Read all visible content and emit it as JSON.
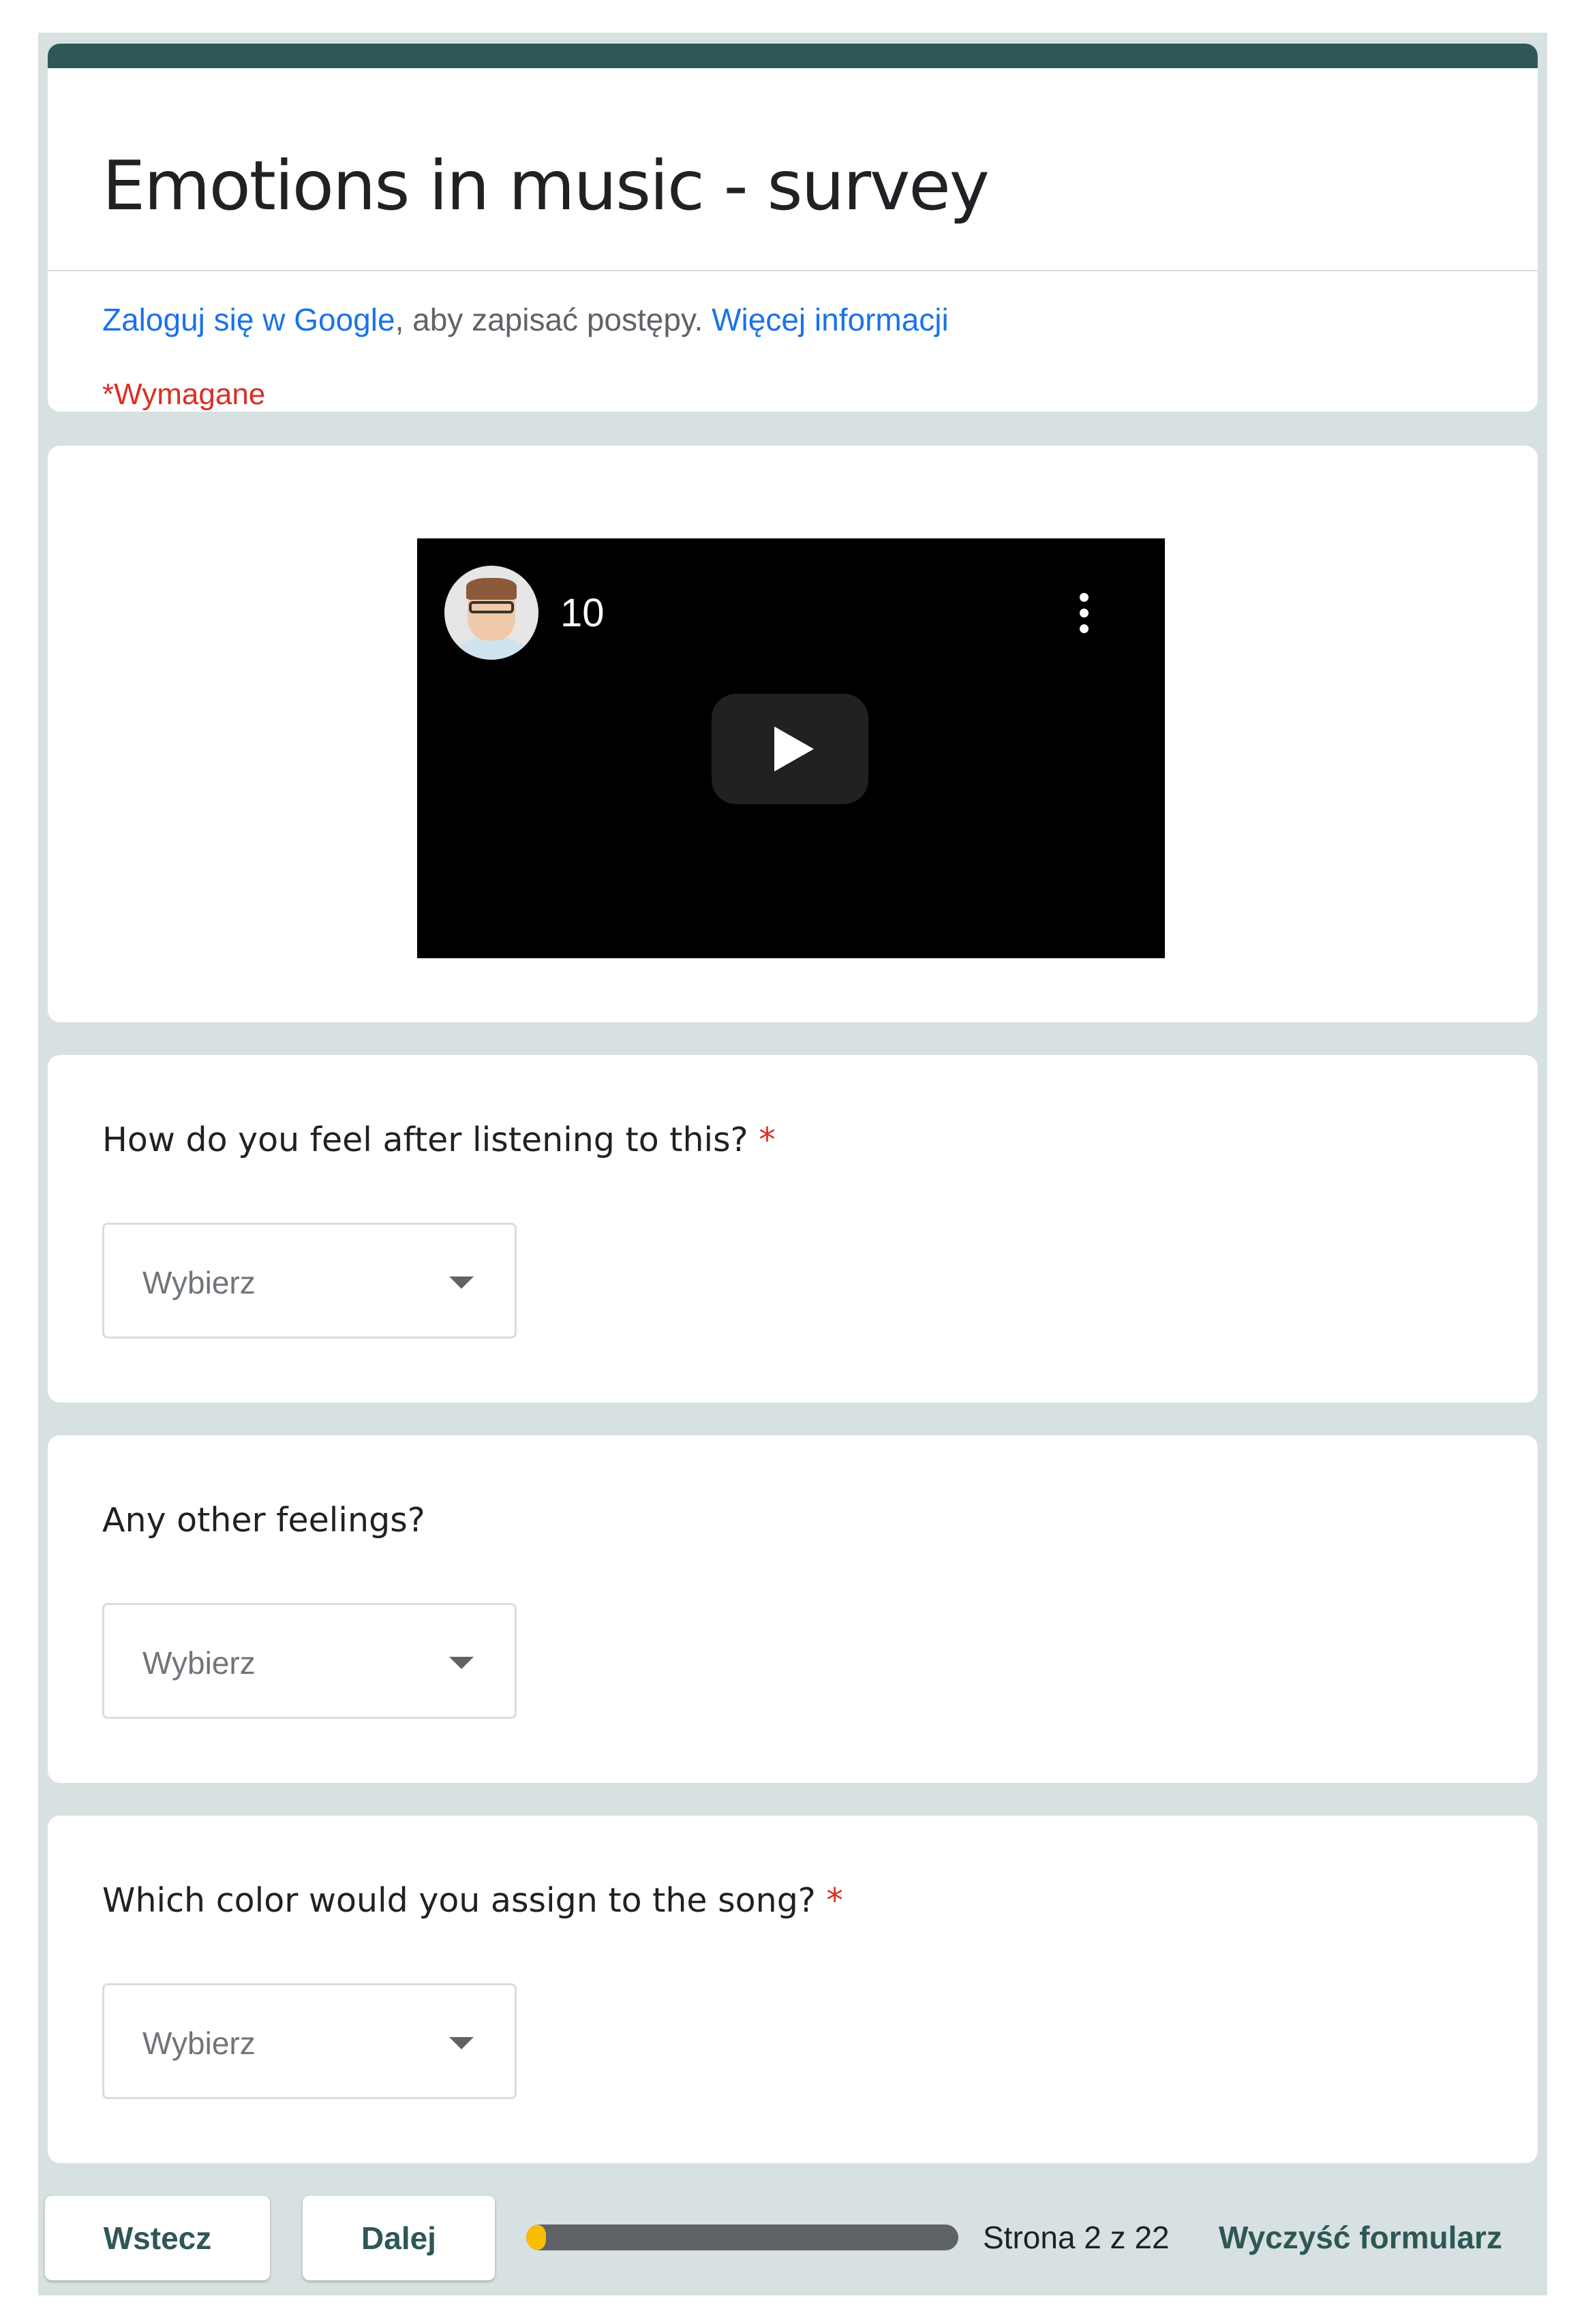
{
  "form": {
    "title": "Emotions in music - survey",
    "signin": {
      "link_text": "Zaloguj się w Google",
      "middle_text": ", aby zapisać postępy. ",
      "more_info_text": "Więcej informacji"
    },
    "required_note": "*Wymagane",
    "accent_color": "#2e5757"
  },
  "video": {
    "title": "10",
    "avatar_icon": "channel-avatar",
    "menu_icon": "more-vert-icon",
    "play_icon": "play-icon"
  },
  "questions": [
    {
      "label": "How do you feel after listening to this?",
      "required_mark": " *",
      "placeholder": "Wybierz"
    },
    {
      "label": "Any other feelings?",
      "required_mark": "",
      "placeholder": "Wybierz"
    },
    {
      "label": "Which color would you assign to the song?",
      "required_mark": " *",
      "placeholder": "Wybierz"
    }
  ],
  "footer": {
    "back_label": "Wstecz",
    "next_label": "Dalej",
    "progress_fraction": 0.045,
    "page_indicator": "Strona 2 z 22",
    "clear_label": "Wyczyść formularz"
  }
}
